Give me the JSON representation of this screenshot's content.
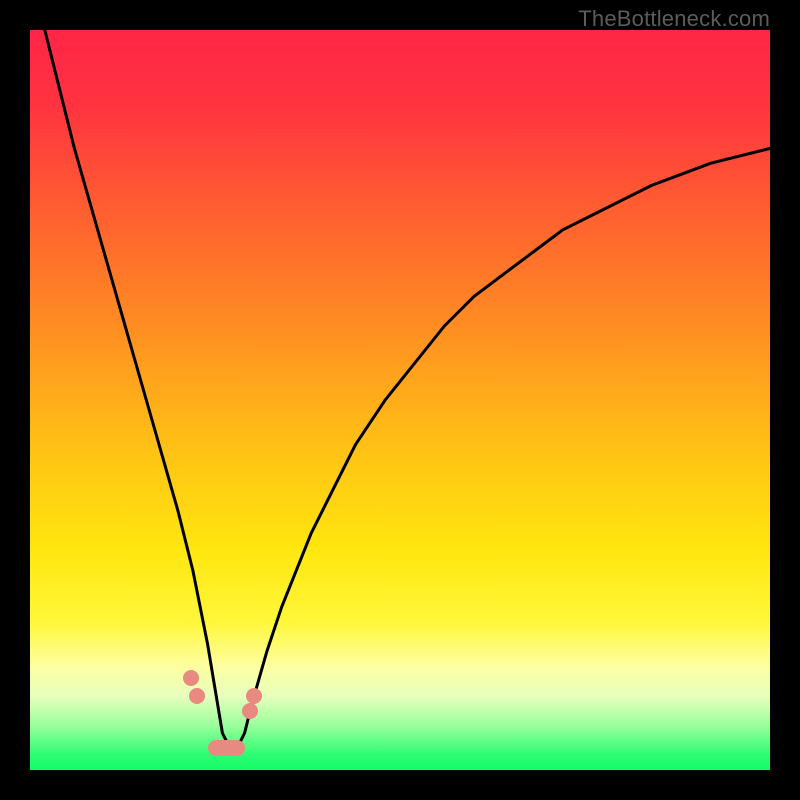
{
  "watermark": "TheBottleneck.com",
  "colors": {
    "frame_bg": "#000000",
    "curve": "#000000",
    "marker": "#e88a7f",
    "gradient_stops": [
      {
        "offset": 0.0,
        "color": "#ff2546"
      },
      {
        "offset": 0.1,
        "color": "#ff3340"
      },
      {
        "offset": 0.25,
        "color": "#ff6030"
      },
      {
        "offset": 0.4,
        "color": "#ff8d22"
      },
      {
        "offset": 0.55,
        "color": "#ffbd16"
      },
      {
        "offset": 0.7,
        "color": "#ffe60e"
      },
      {
        "offset": 0.8,
        "color": "#fff73a"
      },
      {
        "offset": 0.86,
        "color": "#fdffa0"
      },
      {
        "offset": 0.9,
        "color": "#e8ffbd"
      },
      {
        "offset": 0.94,
        "color": "#99ff9c"
      },
      {
        "offset": 0.98,
        "color": "#2bfd72"
      },
      {
        "offset": 1.0,
        "color": "#13fc67"
      }
    ]
  },
  "chart_data": {
    "type": "line",
    "title": "",
    "xlabel": "",
    "ylabel": "",
    "xlim": [
      0,
      100
    ],
    "ylim": [
      0,
      100
    ],
    "grid": false,
    "notes": "V-shaped bottleneck curve. Color gradient ranges from red (high bottleneck) at top through yellow to green (no bottleneck) at bottom. Minimum (optimal) occurs around x≈26.",
    "series": [
      {
        "name": "bottleneck-curve",
        "x": [
          2,
          4,
          6,
          8,
          10,
          12,
          14,
          16,
          18,
          20,
          22,
          23,
          24,
          25,
          26,
          27,
          28,
          29,
          30,
          32,
          34,
          36,
          38,
          40,
          44,
          48,
          52,
          56,
          60,
          64,
          68,
          72,
          76,
          80,
          84,
          88,
          92,
          96,
          100
        ],
        "y": [
          100,
          92,
          84,
          77,
          70,
          63,
          56,
          49,
          42,
          35,
          27,
          22,
          17,
          11,
          5,
          3,
          3,
          5,
          9,
          16,
          22,
          27,
          32,
          36,
          44,
          50,
          55,
          60,
          64,
          67,
          70,
          73,
          75,
          77,
          79,
          80.5,
          82,
          83,
          84
        ]
      }
    ],
    "markers": [
      {
        "type": "point",
        "x": 21.8,
        "y": 12.5
      },
      {
        "type": "point",
        "x": 22.5,
        "y": 10.0
      },
      {
        "type": "segment",
        "x1": 24.0,
        "y1": 3.0,
        "x2": 29.0,
        "y2": 3.0
      },
      {
        "type": "point",
        "x": 29.7,
        "y": 8.0
      },
      {
        "type": "point",
        "x": 30.3,
        "y": 10.0
      }
    ]
  }
}
